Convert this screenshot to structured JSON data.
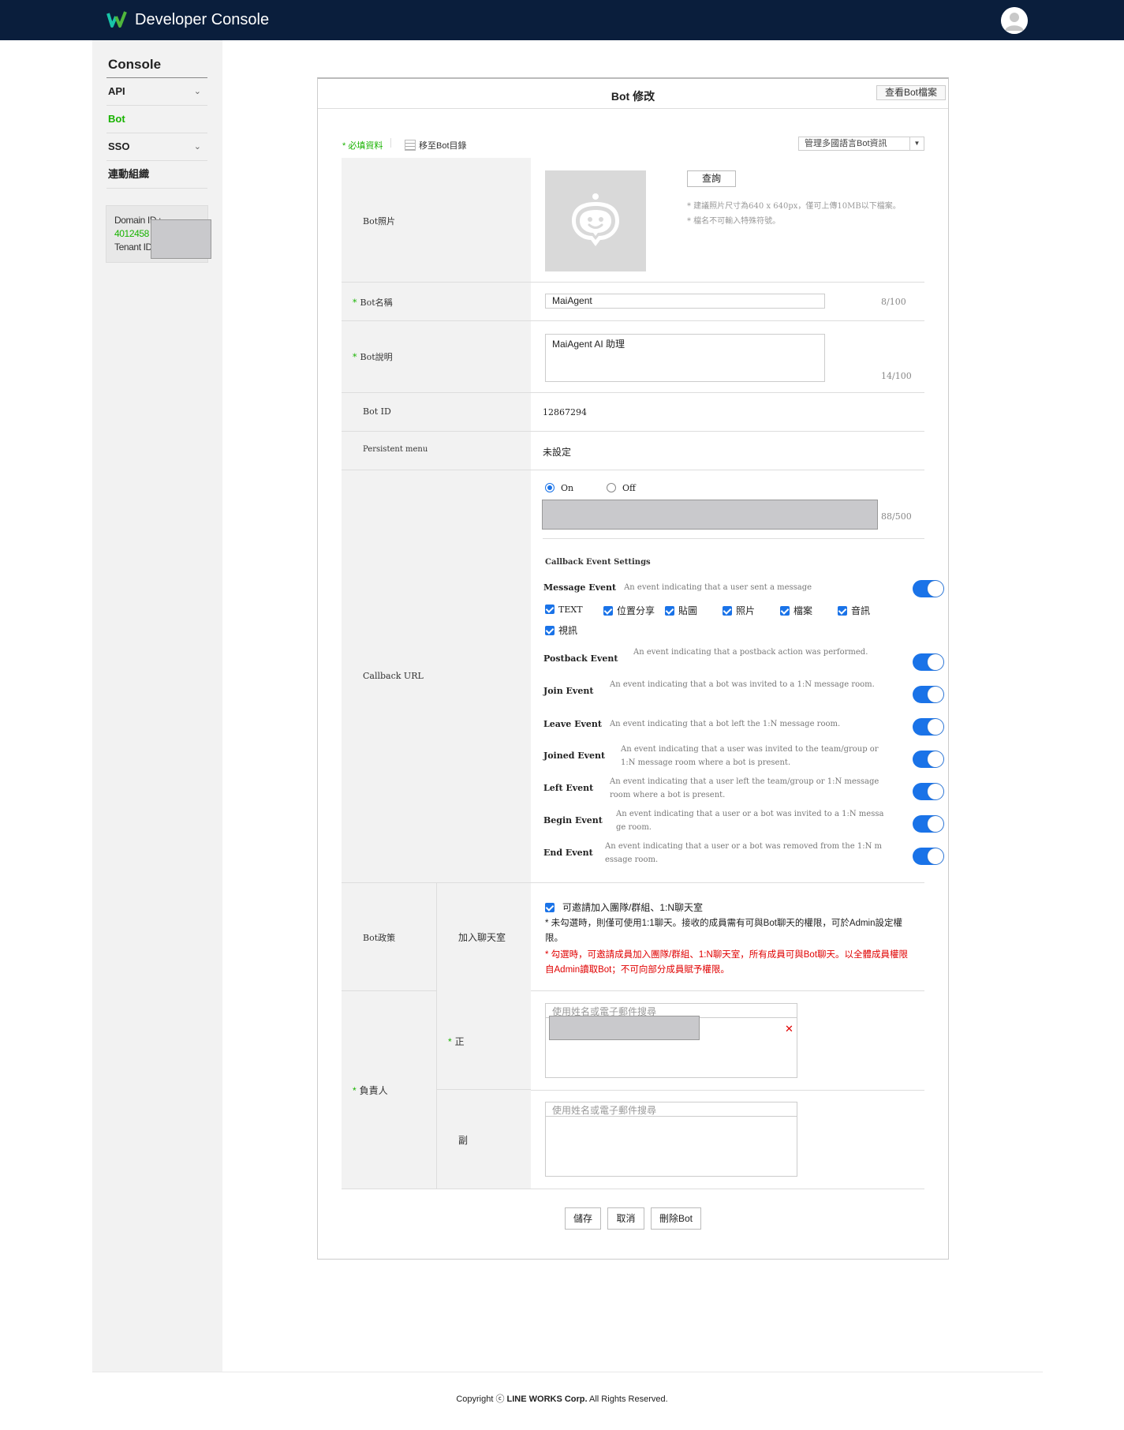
{
  "header": {
    "title": "Developer Console",
    "logo_icon": "line-works-logo",
    "avatar_icon": "user-icon"
  },
  "sidebar": {
    "title": "Console",
    "items": [
      {
        "label": "API",
        "expandable": true
      },
      {
        "label": "Bot",
        "active": true,
        "color": "#18b300"
      },
      {
        "label": "SSO",
        "expandable": true
      },
      {
        "label": "連動組織"
      }
    ],
    "domain": {
      "domain_label": "Domain ID :",
      "domain_value": "4012458",
      "tenant_label": "Tenant ID"
    }
  },
  "panel": {
    "title": "Bot 修改",
    "view_file_button": "查看Bot檔案",
    "required_note": "* 必填資料",
    "move_link": "移至Bot目錄",
    "lang_select": "管理多國語言Bot資訊",
    "photo": {
      "label": "Bot照片",
      "query_button": "查詢",
      "note1": "* 建議照片尺寸為640 x 640px，僅可上傳10MB以下檔案。",
      "note2": "* 檔名不可輸入特殊符號。"
    },
    "name": {
      "label": "Bot名稱",
      "value": "MaiAgent",
      "count": "8/100"
    },
    "desc": {
      "label": "Bot說明",
      "value": "MaiAgent AI 助理",
      "count": "14/100"
    },
    "bot_id": {
      "label": "Bot ID",
      "value": "12867294"
    },
    "menu": {
      "label": "Persistent menu",
      "value": "未設定"
    },
    "callback": {
      "label": "Callback URL",
      "on": "On",
      "off": "Off",
      "selected": "On",
      "count": "88/500",
      "settings_title": "Callback Event Settings",
      "message": {
        "name": "Message Event",
        "desc": "An event indicating that a user sent a message",
        "enabled": true
      },
      "types": [
        "TEXT",
        "位置分享",
        "貼圖",
        "照片",
        "檔案",
        "音訊",
        "視訊"
      ],
      "events": [
        {
          "name": "Postback Event",
          "desc": "An event indicating that a postback action was performed.",
          "enabled": true
        },
        {
          "name": "Join Event",
          "desc": "An event indicating that a bot was invited to a 1:N message room.",
          "enabled": true
        },
        {
          "name": "Leave Event",
          "desc": "An event indicating that a bot left the 1:N message room.",
          "enabled": true
        },
        {
          "name": "Joined Event",
          "desc": "An event indicating that a user was invited to the team/group or 1:N message room where a bot is present.",
          "enabled": true
        },
        {
          "name": "Left Event",
          "desc": "An event indicating that a user left the team/group or 1:N message room where a bot is present.",
          "enabled": true
        },
        {
          "name": "Begin Event",
          "desc": "An event indicating that a user or a bot was invited to a 1:N message room.",
          "enabled": true
        },
        {
          "name": "End Event",
          "desc": "An event indicating that a user or a bot was removed from the 1:N message room.",
          "enabled": true
        }
      ]
    },
    "policy": {
      "label": "Bot政策",
      "sub_label": "加入聊天室",
      "checkbox": "可邀請加入團隊/群組、1:N聊天室",
      "note": "* 未勾選時，則僅可使用1:1聊天。接收的成員需有可與Bot聊天的權限，可於Admin設定權限。",
      "warning": "* 勾選時，可邀請成員加入團隊/群組、1:N聊天室，所有成員可與Bot聊天。以全體成員權限自Admin讀取Bot；不可向部分成員賦予權限。",
      "warning_color": "#e00000"
    },
    "manager": {
      "label": "負責人",
      "primary": "正",
      "secondary": "副",
      "search_placeholder": "使用姓名或電子郵件搜尋"
    },
    "buttons": {
      "save": "儲存",
      "cancel": "取消",
      "delete": "刪除Bot"
    }
  },
  "footer": {
    "copyright": "Copyright ⓒ",
    "company": "LINE WORKS Corp.",
    "rights": "All Rights Reserved."
  }
}
